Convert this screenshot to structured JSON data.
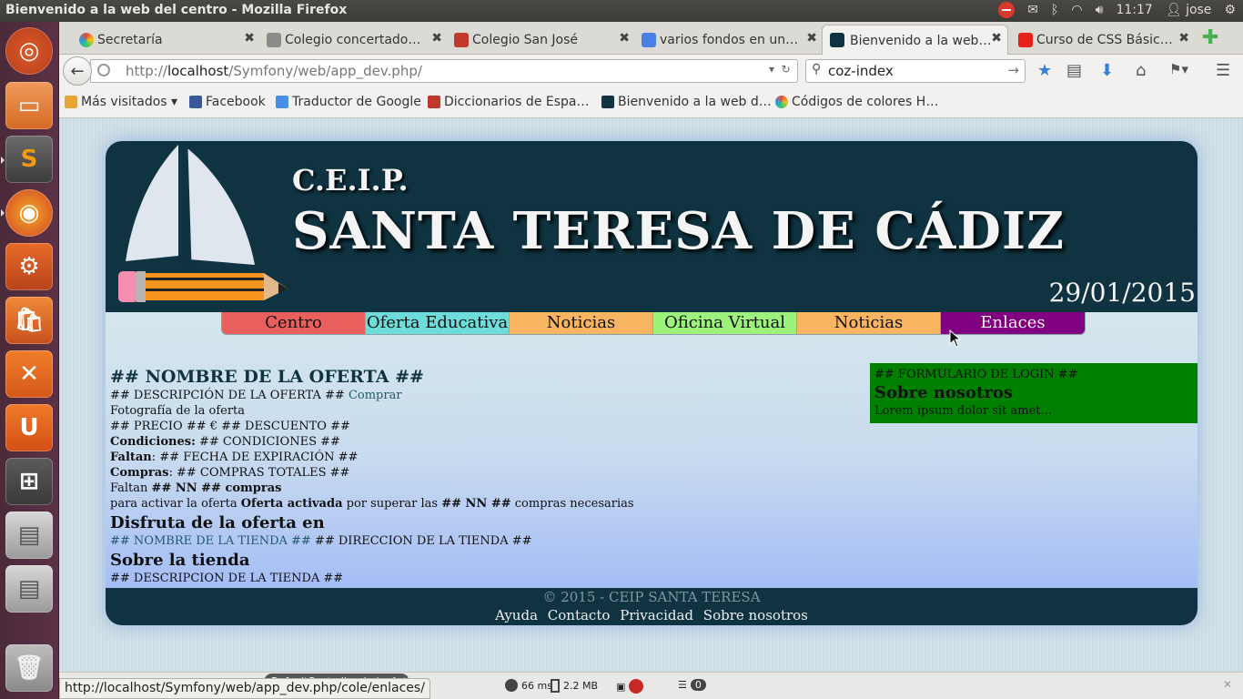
{
  "window": {
    "title": "Bienvenido a la web del centro - Mozilla Firefox",
    "clock": "11:17",
    "user": "jose"
  },
  "tabs": [
    {
      "label": "Secretaría",
      "color": "#e0a21d"
    },
    {
      "label": "Colegio concertado…",
      "color": "#8a8a8a"
    },
    {
      "label": "Colegio San José",
      "color": "#c0392b"
    },
    {
      "label": "varios fondos en un…",
      "color": "#4a7fe5"
    },
    {
      "label": "Bienvenido a la web…",
      "color": "#0f3340"
    },
    {
      "label": "Curso de CSS Básic…",
      "color": "#e62117"
    }
  ],
  "nav": {
    "url_prefix": "http://",
    "url_host": "localhost",
    "url_path": "/Symfony/web/app_dev.php/",
    "search": "coz-index"
  },
  "bookmarks": [
    {
      "label": "Más visitados ▾",
      "color": "#e8a33a"
    },
    {
      "label": "Facebook",
      "color": "#3b5998"
    },
    {
      "label": "Traductor de Google",
      "color": "#4a90e2"
    },
    {
      "label": "Diccionarios de Espa…",
      "color": "#c0392b"
    },
    {
      "label": "Bienvenido a la web d…",
      "color": "#0f3340"
    },
    {
      "label": "Códigos de colores H…",
      "color": "#27ae60"
    }
  ],
  "site": {
    "header_small": "C.E.I.P.",
    "header_big": "SANTA TERESA DE CÁDIZ",
    "date": "29/01/2015",
    "menu": [
      {
        "label": "Centro",
        "color": "#e85f5c"
      },
      {
        "label": "Oferta Educativa",
        "color": "#6fdcdc"
      },
      {
        "label": "Noticias",
        "color": "#f7b562"
      },
      {
        "label": "Oficina Virtual",
        "color": "#9cf27a"
      },
      {
        "label": "Noticias",
        "color": "#f7b562"
      },
      {
        "label": "Enlaces",
        "color": "#800080"
      }
    ],
    "offer": {
      "name": "## NOMBRE DE LA OFERTA ##",
      "description": "## DESCRIPCIÓN DE LA OFERTA ##",
      "buy": "Comprar",
      "photo": "Fotografía de la oferta",
      "price": "## PRECIO ## € ## DESCUENTO ##",
      "conditions_label": "Condiciones:",
      "conditions": "## CONDICIONES ##",
      "remaining_label": "Faltan",
      "remaining": ": ## FECHA DE EXPIRACIÓN ##",
      "purchases_label": "Compras",
      "purchases": ": ## COMPRAS TOTALES ##",
      "need_prefix": "Faltan",
      "need_bold": "## NN ## compras",
      "activate_text": "para activar la oferta",
      "activated_bold": "Oferta activada",
      "activated_mid": "por superar las",
      "activated_nn": "## NN ##",
      "activated_tail": "compras necesarias",
      "enjoy_heading": "Disfruta de la oferta en",
      "store_name": "## NOMBRE DE LA TIENDA ##",
      "store_address": "## DIRECCION DE LA TIENDA ##",
      "about_store_heading": "Sobre la tienda",
      "store_description": "## DESCRIPCION DE LA TIENDA ##"
    },
    "login": {
      "form": "## FORMULARIO DE LOGIN ##",
      "heading": "Sobre nosotros",
      "text": "Lorem ipsum dolor sit amet..."
    },
    "footer": {
      "copyright": "© 2015 - CEIP SANTA TERESA",
      "links": [
        "Ayuda",
        "Contacto",
        "Privacidad",
        "Sobre nosotros"
      ]
    }
  },
  "devbar": {
    "time": "66 ms",
    "memory": "2.2 MB",
    "count": "0",
    "controller": "DefaultController::indexAction"
  },
  "status_url": "http://localhost/Symfony/web/app_dev.php/cole/enlaces/"
}
